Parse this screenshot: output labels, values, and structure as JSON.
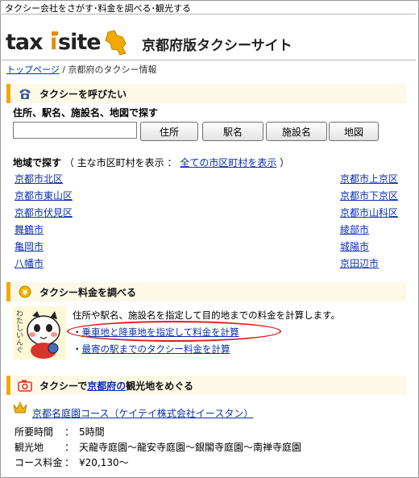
{
  "header": {
    "tagline": "タクシー会社をさがす･料金を調べる･観光する",
    "logo_text": "taxisite",
    "site_title": "京都府版タクシーサイト"
  },
  "breadcrumb": {
    "home": "トップページ",
    "separator": "/",
    "current": "京都府のタクシー情報"
  },
  "call_section": {
    "title": "タクシーを呼びたい",
    "icon": "phone-icon",
    "search_label": "住所、駅名、施設名、地図で探す",
    "search_value": "",
    "buttons": [
      "住所",
      "駅名",
      "施設名",
      "地図"
    ]
  },
  "region": {
    "label": "地域で探す",
    "note_open": "（ 主な市区町村を表示 ：",
    "all_link": "全ての市区町村を表示",
    "note_close": "）",
    "left": [
      "京都市北区",
      "京都市東山区",
      "京都市伏見区",
      "舞鶴市",
      "亀岡市",
      "八幡市"
    ],
    "right": [
      "京都市上京区",
      "京都市下京区",
      "京都市山科区",
      "綾部市",
      "城陽市",
      "京田辺市"
    ]
  },
  "fare_section": {
    "title": "タクシー料金を調べる",
    "icon": "coin-icon",
    "description": "住所や駅名、施設名を指定して目的地までの料金を計算します。",
    "links": [
      "乗車地と降車地を指定して料金を計算",
      "最寄の駅までのタクシー料金を計算"
    ],
    "mascot_caption": "わたしいんぐ"
  },
  "sightseeing_section": {
    "title_prefix": "タクシーで",
    "title_link": "京都府の",
    "title_suffix": "観光地をめぐる",
    "icon": "camera-icon"
  },
  "tour": {
    "icon": "crown-icon",
    "name": "京都名庭園コース（ケイテイ株式会社イースタン）",
    "rows": [
      {
        "key": "所要時間",
        "value": "5時間"
      },
      {
        "key": "観光地",
        "value": "天龍寺庭園～龍安寺庭園～銀閣寺庭園～南禅寺庭園"
      },
      {
        "key": "コース料金",
        "value": "¥20,130～"
      }
    ]
  },
  "colors": {
    "accent": "#f2a900",
    "link": "#0b2fb0",
    "highlight_oval": "#e0201b"
  }
}
